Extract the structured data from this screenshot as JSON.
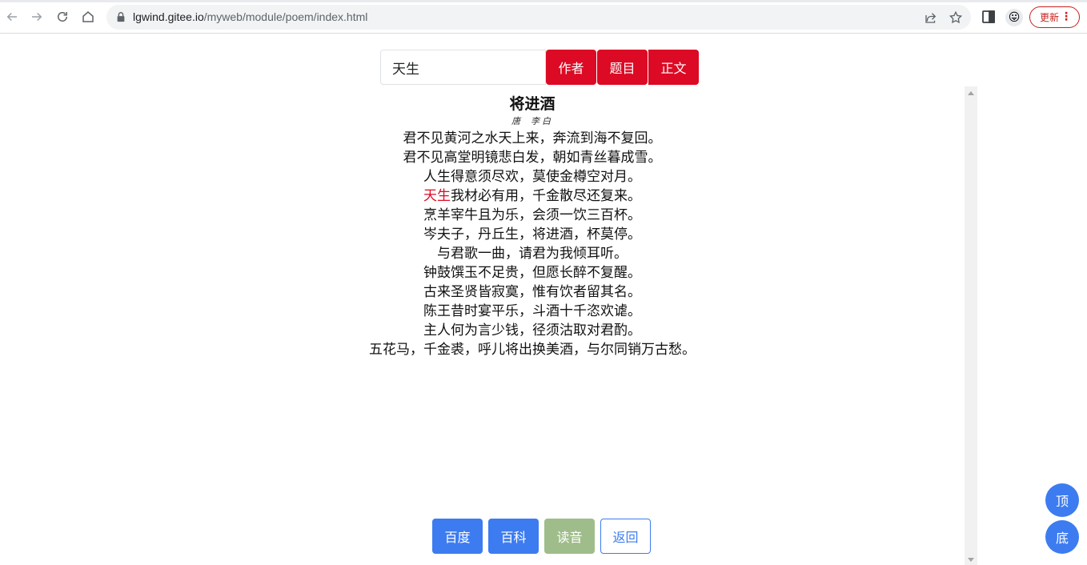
{
  "browser": {
    "url_host": "lgwind.gitee.io",
    "url_path": "/myweb/module/poem/index.html",
    "update_label": "更新",
    "menu_glyph": "⋮"
  },
  "search": {
    "value": "天生",
    "buttons": {
      "author": "作者",
      "title": "题目",
      "body": "正文"
    }
  },
  "poem": {
    "title": "将进酒",
    "dynasty": "唐",
    "author": "李白",
    "highlight_term": "天生",
    "lines": [
      "君不见黄河之水天上来，奔流到海不复回。",
      "君不见高堂明镜悲白发，朝如青丝暮成雪。",
      "人生得意须尽欢，莫使金樽空对月。",
      "天生我材必有用，千金散尽还复来。",
      "烹羊宰牛且为乐，会须一饮三百杯。",
      "岑夫子，丹丘生，将进酒，杯莫停。",
      "与君歌一曲，请君为我倾耳听。",
      "钟鼓馔玉不足贵，但愿长醉不复醒。",
      "古来圣贤皆寂寞，惟有饮者留其名。",
      "陈王昔时宴平乐，斗酒十千恣欢谑。",
      "主人何为言少钱，径须沽取对君酌。",
      "五花马，千金裘，呼儿将出换美酒，与尔同销万古愁。"
    ]
  },
  "actions": {
    "baidu": "百度",
    "baike": "百科",
    "read": "读音",
    "back": "返回"
  },
  "floating": {
    "top": "顶",
    "bottom": "底"
  },
  "colors": {
    "accent_red": "#dc0a24",
    "accent_blue": "#3d7cf0",
    "read_green": "#9fbd8a"
  }
}
